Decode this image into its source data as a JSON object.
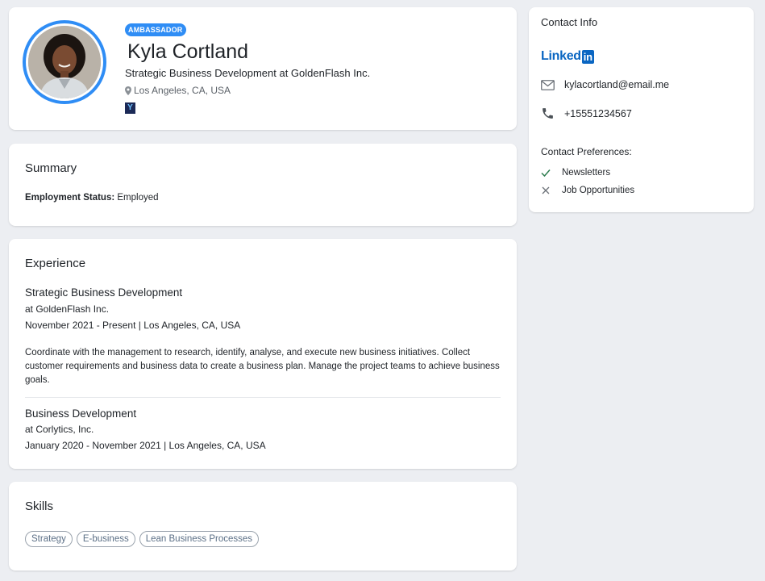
{
  "profile": {
    "badge": "AMBASSADOR",
    "name": "Kyla Cortland",
    "headline": "Strategic Business Development at GoldenFlash Inc.",
    "location": "Los Angeles, CA, USA",
    "ylogo_text": "Y"
  },
  "summary": {
    "title": "Summary",
    "employment_label": "Employment Status:",
    "employment_value": "Employed"
  },
  "experience": {
    "title": "Experience",
    "jobs": [
      {
        "title": "Strategic Business Development",
        "company": "at GoldenFlash Inc.",
        "period": "November 2021 - Present | Los Angeles, CA, USA",
        "description": "Coordinate with the management to research, identify, analyse, and execute new business initiatives. Collect customer requirements and business data to create a business plan. Manage the project teams to achieve business goals."
      },
      {
        "title": "Business Development",
        "company": "at Corlytics, Inc.",
        "period": "January 2020 - November 2021 | Los Angeles, CA, USA"
      }
    ]
  },
  "skills": {
    "title": "Skills",
    "items": [
      "Strategy",
      "E-business",
      "Lean Business Processes"
    ]
  },
  "contact": {
    "title": "Contact Info",
    "linkedin_text": "Linked",
    "linkedin_in": "in",
    "email": "kylacortland@email.me",
    "phone": "+15551234567",
    "preferences_title": "Contact Preferences:",
    "preferences": [
      {
        "label": "Newsletters",
        "state": "check-icon"
      },
      {
        "label": "Job Opportunities",
        "state": "x-icon"
      }
    ]
  },
  "colors": {
    "accent": "#2f8df5",
    "linkedin": "#0a66c2",
    "check": "#2e7d4f"
  }
}
